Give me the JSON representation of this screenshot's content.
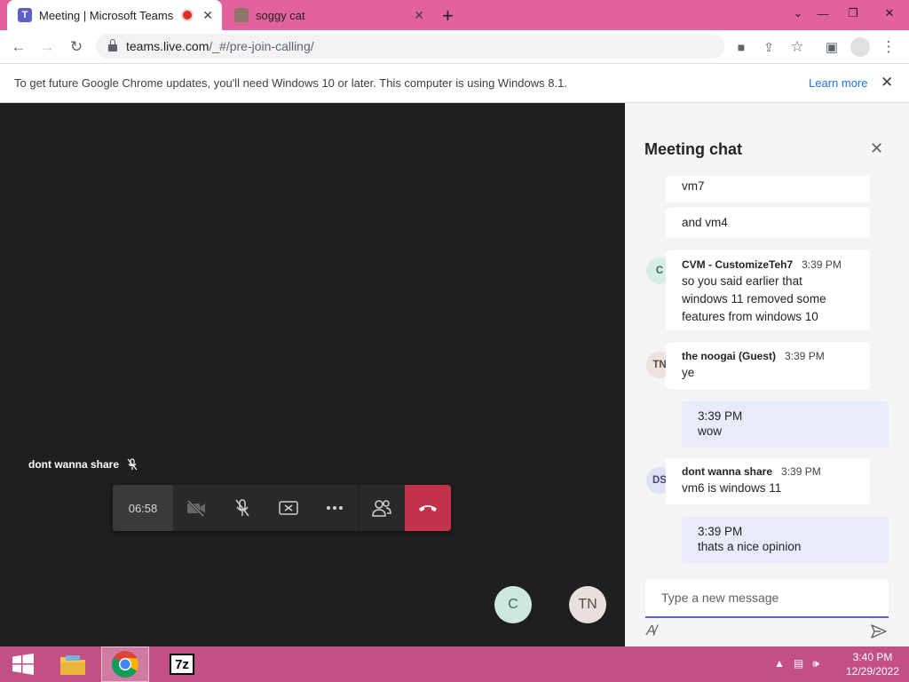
{
  "browser": {
    "tabs": [
      {
        "title": "Meeting | Microsoft Teams",
        "favicon": "teams-icon",
        "recording": true
      },
      {
        "title": "soggy cat",
        "favicon": "cat-photo-icon"
      }
    ],
    "new_tab_label": "+",
    "url_host": "teams.live.com",
    "url_path": "/_#/pre-join-calling/",
    "infobar_message": "To get future Google Chrome updates, you'll need Windows 10 or later. This computer is using Windows 8.1.",
    "infobar_link": "Learn more",
    "tab_strip_color": "#e3619c"
  },
  "meeting": {
    "participant_caption": "dont wanna share",
    "timer": "06:58",
    "hangup_color": "#c4314b",
    "bubbles": [
      {
        "initials": "C"
      },
      {
        "initials": "TN"
      }
    ]
  },
  "chat": {
    "title": "Meeting chat",
    "messages": [
      {
        "text": "vm7"
      },
      {
        "text": "and vm4"
      },
      {
        "author": "CVM - CustomizeTeh7",
        "time": "3:39 PM",
        "avatar": "C",
        "lines": [
          "so you said earlier that",
          "windows 11 removed some",
          "features from windows 10"
        ]
      },
      {
        "author": "the noogai (Guest)",
        "time": "3:39 PM",
        "avatar": "TN",
        "text": "ye"
      },
      {
        "time": "3:39 PM",
        "text": "wow",
        "mine": true
      },
      {
        "author": "dont wanna share",
        "time": "3:39 PM",
        "avatar": "DS",
        "text": "vm6 is windows 11"
      },
      {
        "time": "3:39 PM",
        "text": "thats a nice opinion",
        "mine": true
      }
    ],
    "compose_placeholder": "Type a new message"
  },
  "taskbar": {
    "clock_time": "3:40 PM",
    "clock_date": "12/29/2022",
    "sevenzip_label": "7z",
    "color": "#c24f86"
  }
}
